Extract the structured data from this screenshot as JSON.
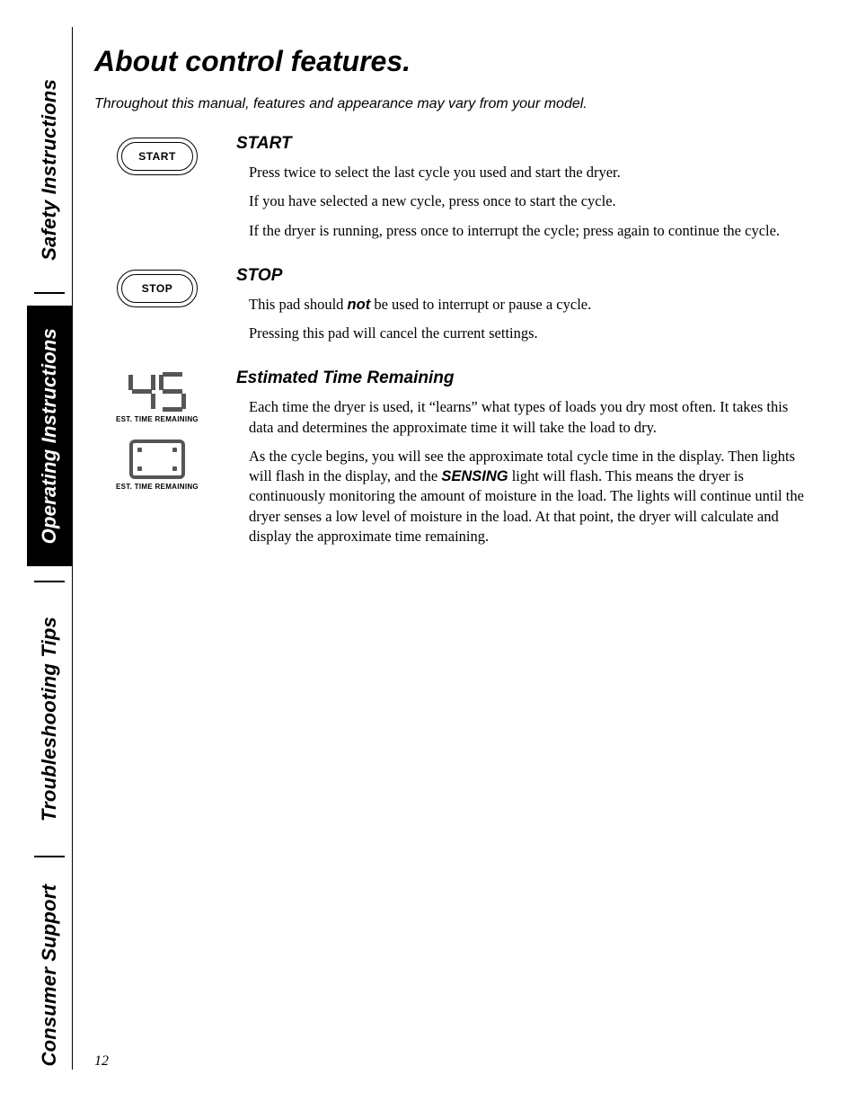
{
  "tabs": {
    "safety": "Safety Instructions",
    "operating": "Operating Instructions",
    "troubleshooting": "Troubleshooting Tips",
    "consumer": "Consumer Support"
  },
  "title": "About control features.",
  "intro": "Throughout this manual, features and appearance may vary from your model.",
  "start": {
    "icon_label": "START",
    "heading": "START",
    "p1": "Press twice to select the last cycle you used and start the dryer.",
    "p2": "If you have selected a new cycle, press once to start the cycle.",
    "p3": "If the dryer is running, press once to interrupt the cycle; press again to continue the cycle."
  },
  "stop": {
    "icon_label": "STOP",
    "heading": "STOP",
    "p1_pre": "This pad should ",
    "p1_bold": "not",
    "p1_post": " be used to interrupt or pause a cycle.",
    "p2": "Pressing this pad will cancel the current settings."
  },
  "etr": {
    "heading": "Estimated Time Remaining",
    "caption": "EST. TIME REMAINING",
    "p1": "Each time the dryer is used, it “learns” what types of loads you dry most often. It takes this data and determines the approximate time it will take the load to dry.",
    "p2_pre": "As the cycle begins, you will see the approximate total cycle time in the display. Then lights will flash in the display, and the ",
    "p2_bold": "SENSING",
    "p2_post": " light will flash. This means the dryer is continuously monitoring the amount of moisture in the load. The lights will continue until the dryer senses a low level of moisture in the load. At that point, the dryer will calculate and display the approximate time remaining."
  },
  "page_number": "12"
}
